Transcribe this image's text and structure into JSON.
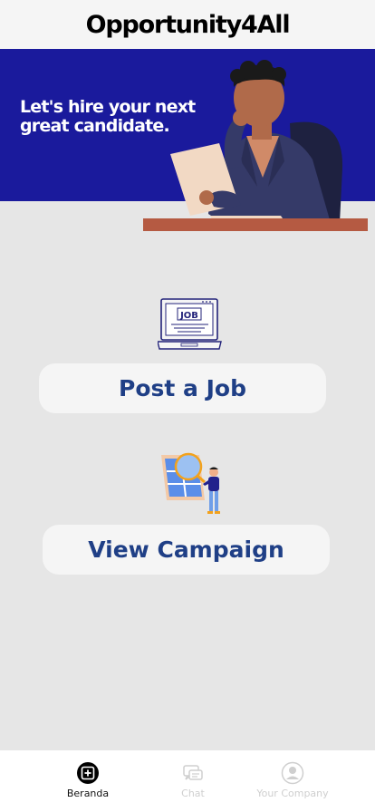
{
  "header": {
    "title": "Opportunity4All"
  },
  "banner": {
    "tagline": "Let's hire your next great candidate."
  },
  "illustrations": {
    "laptop_screen_text": "JOB"
  },
  "actions": {
    "post_job_label": "Post a Job",
    "view_campaign_label": "View Campaign"
  },
  "bottom_nav": {
    "items": [
      {
        "label": "Beranda",
        "icon": "home-plus-icon",
        "active": true
      },
      {
        "label": "Chat",
        "icon": "chat-icon",
        "active": false
      },
      {
        "label": "Your Company",
        "icon": "user-icon",
        "active": false
      }
    ]
  },
  "colors": {
    "banner_bg": "#1a1a9c",
    "button_text": "#1f3f86",
    "page_bg": "#e6e6e6",
    "inactive_nav": "#cfcfcf"
  }
}
